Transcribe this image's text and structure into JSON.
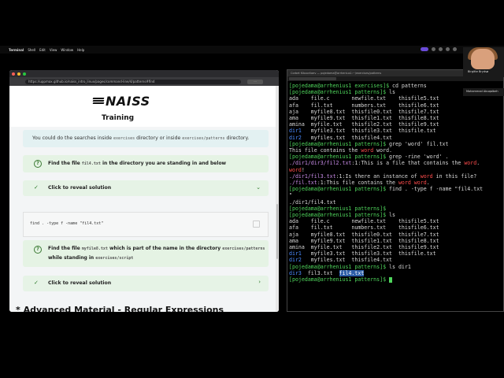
{
  "menubar": {
    "apple": "",
    "items": [
      "Terminal",
      "Shell",
      "Edit",
      "View",
      "Window",
      "Help"
    ]
  },
  "browser": {
    "url": "https://uppmax.github.io/naiss_intro_linux/pages/command-line/4/patterns#find",
    "brand": "NAISS",
    "subtitle": "Training",
    "note": {
      "pre": "You could do the searches inside",
      "code1": "exercises",
      "mid": "directory or inside",
      "code2": "exercises/patterns",
      "post": "directory."
    },
    "task1": {
      "pre": "Find the file",
      "code": "fil4.txt",
      "post": "in the directory you are standing in and below"
    },
    "reveal1": {
      "label": "Click to reveal solution",
      "code": "find . -type f -name \"fil4.txt\""
    },
    "task2": {
      "pre": "Find the file",
      "code": "myfile8.txt",
      "mid": "which is part of the name in the directory",
      "code2": "exercises/patterns",
      "line2_pre": "while standing in",
      "line2_code": "exercises/script"
    },
    "reveal2": {
      "label": "Click to reveal solution"
    },
    "advanced": "Advanced Material - Regular Expressions"
  },
  "terminal": {
    "title": "Corbet Kiboorliaev — pojedama@arrhenius1:~/exercises/patterns",
    "tab": "pojedama@arrhenius1"
  },
  "participants": [
    {
      "name": "Birgitte Brydsø"
    },
    {
      "name": "Mohammad Abuqalbeh"
    }
  ],
  "colors": {
    "term_green": "#4fd65c",
    "term_blue": "#4b8bff",
    "term_red": "#ff4c4c",
    "accent": "#6a4bd8"
  }
}
